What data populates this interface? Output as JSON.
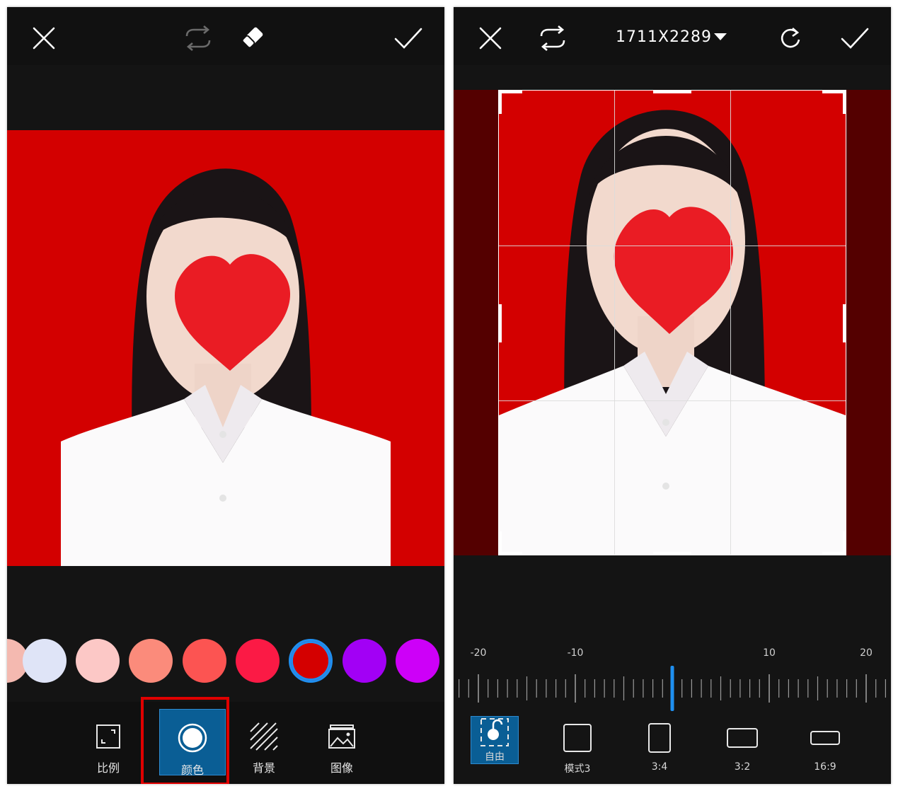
{
  "colors": {
    "accent": "#1f8ff0",
    "active_tool_bg": "#0a5e95",
    "photo_background": "#d30000",
    "highlight": "#e00000"
  },
  "left": {
    "topbar": {
      "icons": [
        "close-icon",
        "swap-icon",
        "eraser-icon",
        "confirm-check-icon"
      ]
    },
    "swatches": [
      "#f4b9b0",
      "#dfe4f7",
      "#fcc8c6",
      "#fb8b7b",
      "#fc5452",
      "#fb1a45",
      "#d40000",
      "#a200f5",
      "#cd00f8"
    ],
    "selected_swatch_index": 6,
    "tools": [
      {
        "label": "比例",
        "icon": "expand-frame-icon"
      },
      {
        "label": "颜色",
        "icon": "color-circle-icon"
      },
      {
        "label": "背景",
        "icon": "diagonal-lines-icon"
      },
      {
        "label": "图像",
        "icon": "image-icon"
      }
    ],
    "active_tool_index": 1
  },
  "right": {
    "topbar": {
      "size_label": "1711X2289",
      "icons": [
        "close-icon",
        "swap-icon",
        "dropdown-caret-icon",
        "redo-icon",
        "confirm-check-icon"
      ]
    },
    "ruler": {
      "labels": [
        "-20",
        "-10",
        "10",
        "20"
      ],
      "value": 0
    },
    "ratios": [
      {
        "label": "自由",
        "icon": "free-crop-icon"
      },
      {
        "label": "模式3",
        "icon": "square-shape-icon"
      },
      {
        "label": "3:4",
        "icon": "portrait-rect-icon"
      },
      {
        "label": "3:2",
        "icon": "landscape-rect-icon"
      },
      {
        "label": "16:9",
        "icon": "wide-rect-icon"
      }
    ],
    "active_ratio_index": 0
  }
}
